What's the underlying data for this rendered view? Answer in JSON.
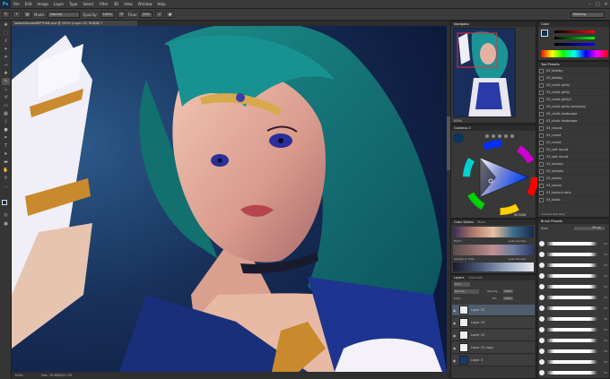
{
  "app": {
    "logo": "Ps",
    "menu": [
      "File",
      "Edit",
      "Image",
      "Layer",
      "Type",
      "Select",
      "Filter",
      "3D",
      "View",
      "Window",
      "Help"
    ],
    "window_buttons": [
      "–",
      "▢",
      "✕"
    ]
  },
  "options_bar": {
    "mode_label": "Mode:",
    "mode_value": "Normal",
    "opacity_label": "Opacity:",
    "opacity_value": "100%",
    "flow_label": "Flow:",
    "flow_value": "29%",
    "workspace": "Painting"
  },
  "document": {
    "tab_title": "sailorblkcolorNEPTUNE.psd @ 100% (Layer 25, RGB/8) *",
    "zoom": "100%",
    "doc_size": "Doc: 19.8M/525.7M"
  },
  "navigator": {
    "title": "Navigator",
    "zoom": "100%"
  },
  "color_wheel_panel": {
    "title": "Coolorus 2",
    "hex_value": "0E3458"
  },
  "swatches_panel": {
    "tabs": [
      "Color Sliders",
      "Mixer"
    ],
    "row1_label": "Hatch",
    "row1_right": "Auto-Sample",
    "row2_label": "Shades & Tints",
    "row2_right": "Auto-Sample"
  },
  "layers_panel": {
    "tabs": [
      "Layers",
      "Channels"
    ],
    "kind_label": "Kind",
    "blend_mode": "Normal",
    "opacity_label": "Opacity:",
    "opacity_value": "100%",
    "lock_label": "Lock:",
    "fill_label": "Fill:",
    "fill_value": "100%",
    "layers": [
      {
        "name": "Layer 25",
        "selected": true
      },
      {
        "name": "Layer 24",
        "selected": false
      },
      {
        "name": "Layer 23",
        "selected": false
      },
      {
        "name": "Layer 22 copy",
        "selected": false
      },
      {
        "name": "Layer 3",
        "selected": false
      }
    ]
  },
  "color_panel": {
    "title": "Color"
  },
  "tool_presets": {
    "title": "Tool Presets",
    "items": [
      "02_blobby",
      "03_blobby",
      "03_chalk gritty",
      "03_chalk gritty",
      "03_chalk gritty2",
      "03_chalk gritty smearing",
      "03_chalk landscape",
      "03_chalk landscape",
      "03_clouds",
      "03_round",
      "03_round",
      "03_soft round",
      "03_soft round",
      "03_streaky",
      "03_streaky",
      "03_wacky",
      "03_wacky",
      "03_texture dots",
      "03_blobs"
    ],
    "footer": "Current Tool Only"
  },
  "brush_presets": {
    "title": "Brush Presets",
    "size_label": "Size:",
    "size_value": "25 px",
    "sizes": [
      "25",
      "30",
      "30",
      "30",
      "50",
      "25",
      "25",
      "36",
      "25",
      "25",
      "36",
      "36",
      "32",
      "25"
    ]
  },
  "colors": {
    "accent": "#31a8ff",
    "selected_layer": "#4f5d6e",
    "foreground": "#0e3458"
  }
}
